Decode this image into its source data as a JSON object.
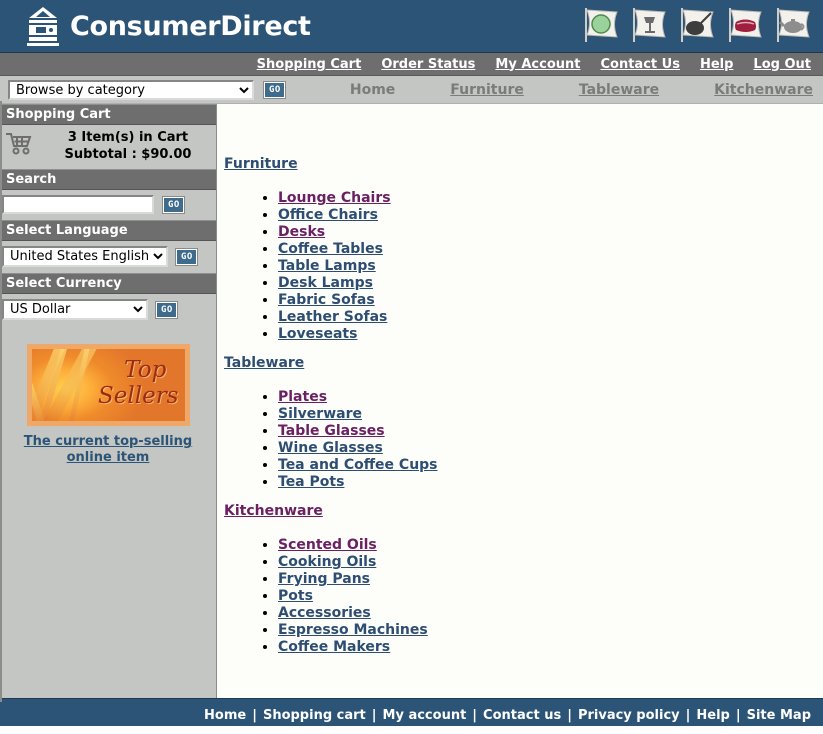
{
  "header": {
    "brand": "ConsumerDirect",
    "logo_icon": "house-logo-icon",
    "flags": [
      {
        "name": "flag-icon-plate",
        "glyph": "plate"
      },
      {
        "name": "flag-icon-lamp",
        "glyph": "lamp"
      },
      {
        "name": "flag-icon-frying-pan",
        "glyph": "pan"
      },
      {
        "name": "flag-icon-sofa",
        "glyph": "sofa"
      },
      {
        "name": "flag-icon-teapot",
        "glyph": "teapot"
      }
    ]
  },
  "topnav": {
    "items": [
      {
        "label": "Shopping Cart",
        "name": "topnav-shopping-cart"
      },
      {
        "label": "Order Status",
        "name": "topnav-order-status"
      },
      {
        "label": "My Account",
        "name": "topnav-my-account"
      },
      {
        "label": "Contact Us",
        "name": "topnav-contact-us"
      },
      {
        "label": "Help",
        "name": "topnav-help"
      },
      {
        "label": "Log Out",
        "name": "topnav-log-out"
      }
    ]
  },
  "subnav": {
    "browse_selected": "Browse by category",
    "browse_options": [
      "Browse by category"
    ],
    "go_label": "GO",
    "categories": [
      {
        "label": "Home",
        "name": "subnav-home",
        "current": true
      },
      {
        "label": "Furniture",
        "name": "subnav-furniture",
        "current": false
      },
      {
        "label": "Tableware",
        "name": "subnav-tableware",
        "current": false
      },
      {
        "label": "Kitchenware",
        "name": "subnav-kitchenware",
        "current": false
      }
    ]
  },
  "sidebar": {
    "cart": {
      "heading": "Shopping Cart",
      "icon": "shopping-cart-icon",
      "items_line": "3 Item(s) in Cart",
      "subtotal_line": "Subtotal : $90.00"
    },
    "search": {
      "heading": "Search",
      "value": "",
      "placeholder": "",
      "go_label": "GO"
    },
    "language": {
      "heading": "Select Language",
      "selected": "United States English",
      "options": [
        "United States English"
      ],
      "go_label": "GO"
    },
    "currency": {
      "heading": "Select Currency",
      "selected": "US Dollar",
      "options": [
        "US Dollar"
      ],
      "go_label": "GO"
    },
    "promo": {
      "banner_line1": "Top",
      "banner_line2": "Sellers",
      "link_text": "The current top-selling online item"
    }
  },
  "main": {
    "sections": [
      {
        "title": "Furniture",
        "title_visited": false,
        "name": "section-furniture",
        "links": [
          {
            "label": "Lounge Chairs",
            "visited": true
          },
          {
            "label": "Office Chairs",
            "visited": false
          },
          {
            "label": "Desks",
            "visited": true
          },
          {
            "label": "Coffee Tables",
            "visited": false
          },
          {
            "label": "Table Lamps",
            "visited": false
          },
          {
            "label": "Desk Lamps",
            "visited": false
          },
          {
            "label": "Fabric Sofas",
            "visited": false
          },
          {
            "label": "Leather Sofas",
            "visited": false
          },
          {
            "label": "Loveseats",
            "visited": false
          }
        ]
      },
      {
        "title": "Tableware",
        "title_visited": false,
        "name": "section-tableware",
        "links": [
          {
            "label": "Plates",
            "visited": true
          },
          {
            "label": "Silverware",
            "visited": false
          },
          {
            "label": "Table Glasses",
            "visited": true
          },
          {
            "label": "Wine Glasses",
            "visited": false
          },
          {
            "label": "Tea and Coffee Cups",
            "visited": false
          },
          {
            "label": "Tea Pots",
            "visited": false
          }
        ]
      },
      {
        "title": "Kitchenware",
        "title_visited": true,
        "name": "section-kitchenware",
        "links": [
          {
            "label": "Scented Oils",
            "visited": true
          },
          {
            "label": "Cooking Oils",
            "visited": false
          },
          {
            "label": "Frying Pans",
            "visited": false
          },
          {
            "label": "Pots",
            "visited": false
          },
          {
            "label": "Accessories",
            "visited": false
          },
          {
            "label": "Espresso Machines",
            "visited": false
          },
          {
            "label": "Coffee Makers",
            "visited": false
          }
        ]
      }
    ]
  },
  "footer": {
    "separator": "|",
    "items": [
      {
        "label": "Home",
        "name": "footer-home"
      },
      {
        "label": "Shopping cart",
        "name": "footer-shopping-cart"
      },
      {
        "label": "My account",
        "name": "footer-my-account"
      },
      {
        "label": "Contact us",
        "name": "footer-contact-us"
      },
      {
        "label": "Privacy policy",
        "name": "footer-privacy-policy"
      },
      {
        "label": "Help",
        "name": "footer-help"
      },
      {
        "label": "Site Map",
        "name": "footer-site-map"
      }
    ]
  },
  "colors": {
    "brand_blue": "#2b5477",
    "nav_gray": "#6e6e6e",
    "panel_gray": "#c4c6c3",
    "link_blue": "#2d4d72",
    "link_visited": "#6a2062",
    "content_bg": "#fdfefa",
    "promo_orange": "#ef8f36"
  }
}
